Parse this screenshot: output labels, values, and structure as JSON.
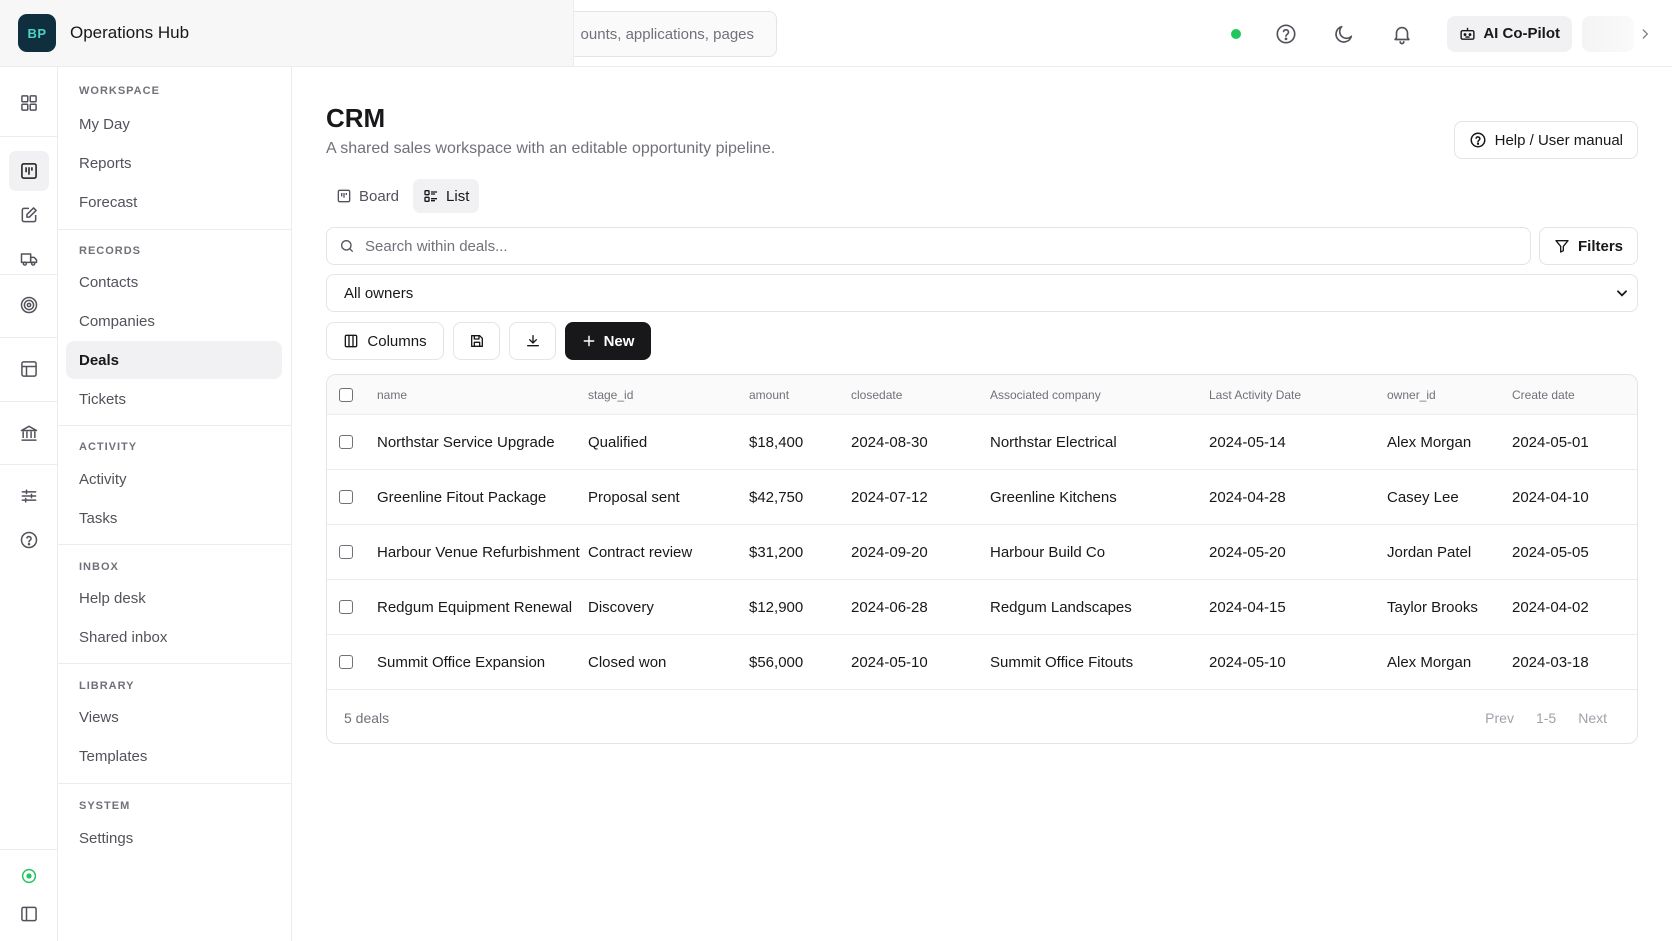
{
  "brand": {
    "logo_text": "BP",
    "name": "Operations Hub"
  },
  "global_search": {
    "placeholder": "ounts, applications, pages"
  },
  "topbar": {
    "copilot_label": "AI Co-Pilot",
    "status_color": "#22c55e"
  },
  "sidebar": {
    "sections": [
      {
        "label": "WORKSPACE",
        "items": [
          "My Day",
          "Reports",
          "Forecast"
        ]
      },
      {
        "label": "RECORDS",
        "items": [
          "Contacts",
          "Companies",
          "Deals",
          "Tickets"
        ]
      },
      {
        "label": "ACTIVITY",
        "items": [
          "Activity",
          "Tasks"
        ]
      },
      {
        "label": "INBOX",
        "items": [
          "Help desk",
          "Shared inbox"
        ]
      },
      {
        "label": "LIBRARY",
        "items": [
          "Views",
          "Templates"
        ]
      },
      {
        "label": "SYSTEM",
        "items": [
          "Settings"
        ]
      }
    ],
    "active_item": "Deals"
  },
  "page": {
    "title": "CRM",
    "subtitle": "A shared sales workspace with an editable opportunity pipeline.",
    "help_label": "Help / User manual",
    "tabs": [
      "Board",
      "List"
    ],
    "active_tab": "List",
    "search_placeholder": "Search within deals...",
    "filters_label": "Filters",
    "owner_filter": "All owners",
    "columns_label": "Columns",
    "new_label": "New"
  },
  "table": {
    "headers": [
      "name",
      "stage_id",
      "amount",
      "closedate",
      "Associated company",
      "Last Activity Date",
      "owner_id",
      "Create date"
    ],
    "rows": [
      [
        "Northstar Service Upgrade",
        "Qualified",
        "$18,400",
        "2024-08-30",
        "Northstar Electrical",
        "2024-05-14",
        "Alex Morgan",
        "2024-05-01"
      ],
      [
        "Greenline Fitout Package",
        "Proposal sent",
        "$42,750",
        "2024-07-12",
        "Greenline Kitchens",
        "2024-04-28",
        "Casey Lee",
        "2024-04-10"
      ],
      [
        "Harbour Venue Refurbishment",
        "Contract review",
        "$31,200",
        "2024-09-20",
        "Harbour Build Co",
        "2024-05-20",
        "Jordan Patel",
        "2024-05-05"
      ],
      [
        "Redgum Equipment Renewal",
        "Discovery",
        "$12,900",
        "2024-06-28",
        "Redgum Landscapes",
        "2024-04-15",
        "Taylor Brooks",
        "2024-04-02"
      ],
      [
        "Summit Office Expansion",
        "Closed won",
        "$56,000",
        "2024-05-10",
        "Summit Office Fitouts",
        "2024-05-10",
        "Alex Morgan",
        "2024-03-18"
      ]
    ],
    "footer_count": "5 deals",
    "pager": {
      "prev": "Prev",
      "range": "1-5",
      "next": "Next"
    }
  }
}
